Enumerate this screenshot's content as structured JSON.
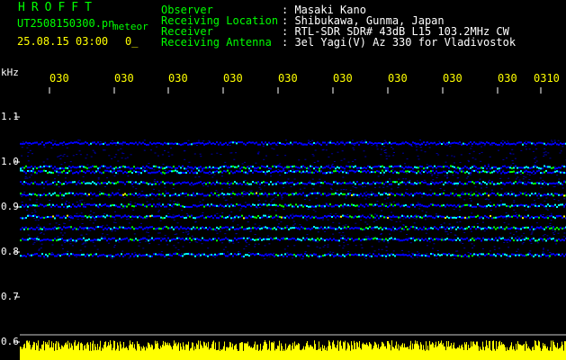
{
  "app": {
    "logo": "HROFFT"
  },
  "header": {
    "filename": "UT2508150300.pn",
    "meteor_label": "meteor",
    "date_time": "25.08.15 03:00",
    "count": "0_",
    "fields": [
      {
        "label": "Observer",
        "value": ": Masaki Kano"
      },
      {
        "label": "Receiving Location",
        "value": ": Shibukawa, Gunma, Japan"
      },
      {
        "label": "Receiver",
        "value": ": RTL-SDR SDR# 43dB L15 103.2MHz CW"
      },
      {
        "label": "Receiving Antenna",
        "value": ": 3el Yagi(V) Az 330 for Vladivostok"
      }
    ]
  },
  "chart_data": {
    "type": "heatmap",
    "ylabel": "kHz",
    "yticks": [
      "1.1",
      "1.0",
      "0.9",
      "0.8",
      "0.7",
      "0.6"
    ],
    "xticks": [
      "030",
      "030",
      "030",
      "030",
      "030",
      "030",
      "030",
      "030",
      "030",
      "0310"
    ],
    "ylim": [
      0.6,
      1.1
    ],
    "bands_khz": [
      1.043,
      0.99,
      0.98,
      0.955,
      0.93,
      0.905,
      0.88,
      0.855,
      0.83,
      0.795
    ],
    "colors": {
      "background": "#000000",
      "low": "#0000ff",
      "mid": "#00ff00",
      "high": "#ff0000",
      "grid": "#ffffff",
      "noise_bar": "#ffff00"
    }
  }
}
